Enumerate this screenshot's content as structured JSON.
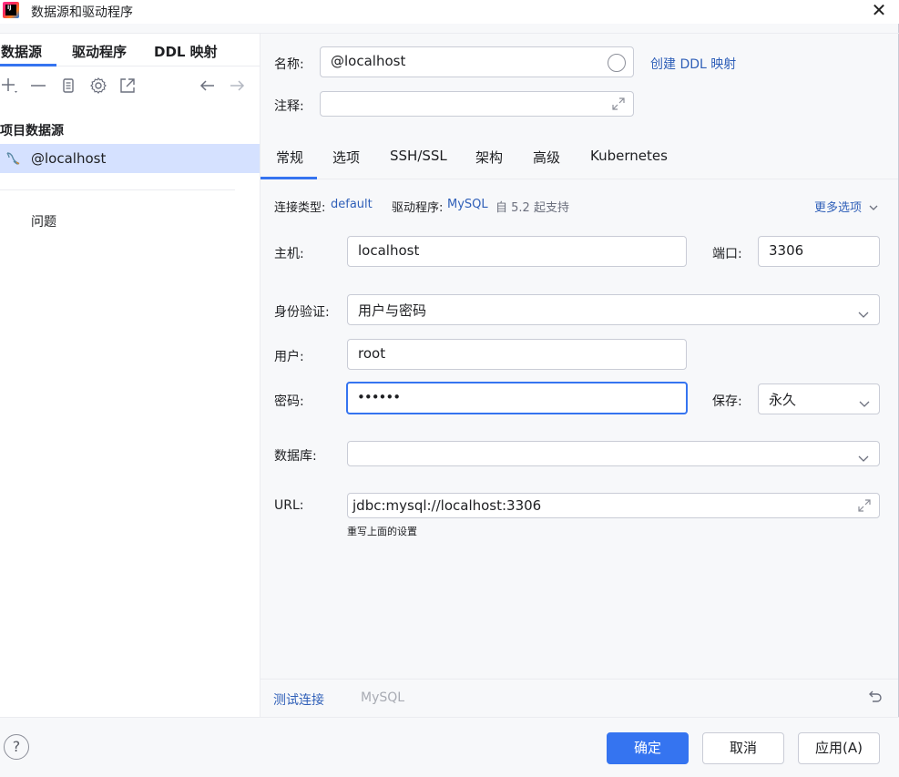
{
  "window": {
    "title": "数据源和驱动程序",
    "close_glyph": "✕"
  },
  "left": {
    "tabs": [
      "数据源",
      "驱动程序",
      "DDL 映射"
    ],
    "toolbar_icons": [
      "add-icon",
      "remove-icon",
      "copy-icon",
      "settings-icon",
      "open-external-icon",
      "back-arrow-icon",
      "forward-arrow-icon"
    ],
    "section_title": "项目数据源",
    "items": [
      {
        "label": "@localhost",
        "icon": "mysql-dolphin-icon"
      }
    ],
    "problems_label": "问题"
  },
  "header": {
    "name_label": "名称:",
    "name_value": "@localhost",
    "create_ddl_link": "创建 DDL 映射",
    "comment_label": "注释:",
    "comment_value": ""
  },
  "tabs": [
    "常规",
    "选项",
    "SSH/SSL",
    "架构",
    "高级",
    "Kubernetes"
  ],
  "connection": {
    "type_label": "连接类型:",
    "type_value": "default",
    "driver_label": "驱动程序:",
    "driver_value": "MySQL",
    "driver_support": "自 5.2 起支持",
    "more_options": "更多选项"
  },
  "form": {
    "host_label": "主机:",
    "host_value": "localhost",
    "port_label": "端口:",
    "port_value": "3306",
    "auth_label": "身份验证:",
    "auth_value": "用户与密码",
    "user_label": "用户:",
    "user_value": "root",
    "password_label": "密码:",
    "password_value": "••••••",
    "save_label": "保存:",
    "save_value": "永久",
    "database_label": "数据库:",
    "database_value": "",
    "url_label": "URL:",
    "url_value": "jdbc:mysql://localhost:3306",
    "url_hint": "重写上面的设置"
  },
  "bottom": {
    "test_connection": "测试连接",
    "driver_name": "MySQL"
  },
  "footer": {
    "help": "?",
    "ok": "确定",
    "cancel": "取消",
    "apply": "应用(A)"
  },
  "colors": {
    "accent": "#3574f0",
    "link": "#2f5fb8",
    "selection": "#d5e1ff"
  }
}
